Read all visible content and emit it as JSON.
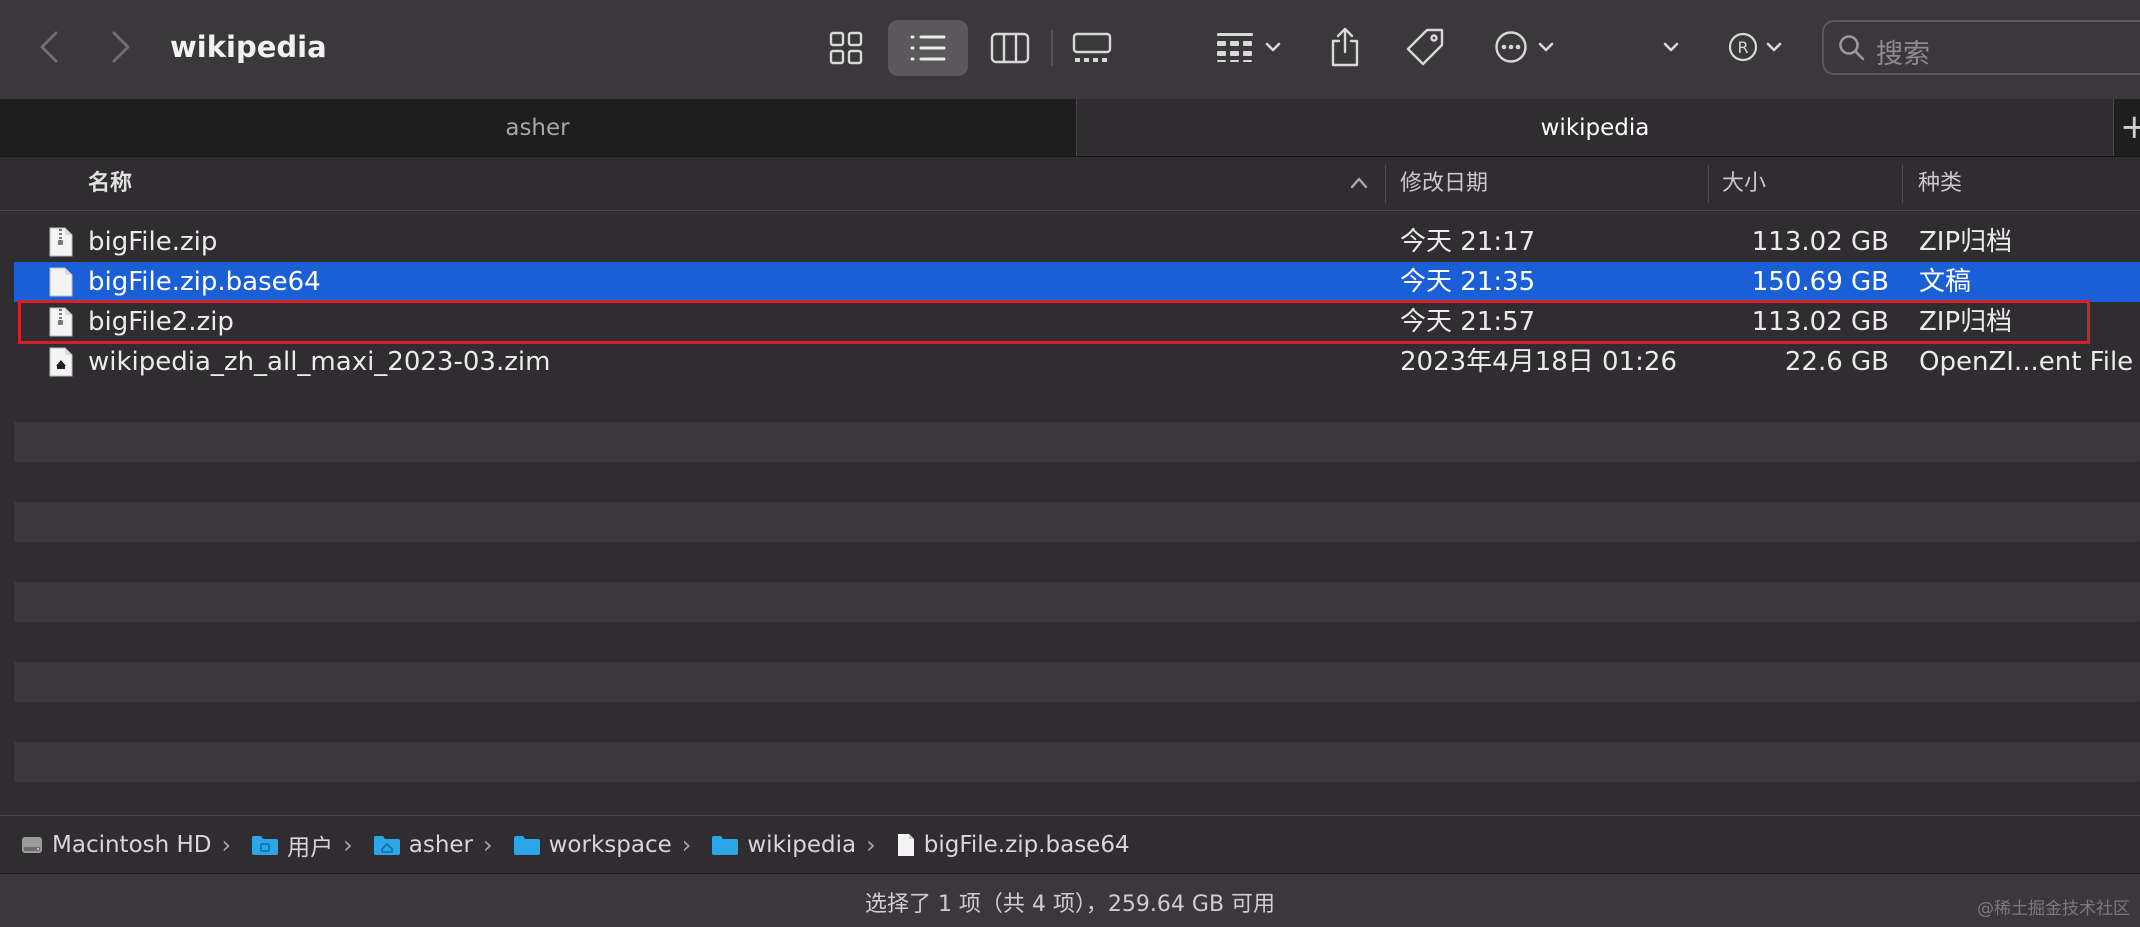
{
  "window": {
    "title": "wikipedia",
    "search_placeholder": "搜索"
  },
  "toolbar": {
    "icons": [
      "chevron-left-icon",
      "chevron-right-icon",
      "icon-view-icon",
      "list-view-icon",
      "column-view-icon",
      "gallery-view-icon",
      "group-icon",
      "share-icon",
      "tag-icon",
      "more-icon",
      "chevron-down-icon",
      "registered-icon",
      "search-icon"
    ]
  },
  "tabs": [
    {
      "label": "asher"
    },
    {
      "label": "wikipedia"
    }
  ],
  "columns": {
    "name": "名称",
    "date": "修改日期",
    "size": "大小",
    "kind": "种类"
  },
  "files": [
    {
      "name": "bigFile.zip",
      "date": "今天 21:17",
      "size": "113.02 GB",
      "kind": "ZIP归档",
      "selected": false
    },
    {
      "name": "bigFile.zip.base64",
      "date": "今天 21:35",
      "size": "150.69 GB",
      "kind": "文稿",
      "selected": true
    },
    {
      "name": "bigFile2.zip",
      "date": "今天 21:57",
      "size": "113.02 GB",
      "kind": "ZIP归档",
      "selected": false
    },
    {
      "name": "wikipedia_zh_all_maxi_2023-03.zim",
      "date": "2023年4月18日 01:26",
      "size": "22.6 GB",
      "kind": "OpenZI...ent File",
      "selected": false
    }
  ],
  "path": [
    {
      "label": "Macintosh HD",
      "icon": "hard-drive-icon"
    },
    {
      "label": "用户",
      "icon": "folder-icon"
    },
    {
      "label": "asher",
      "icon": "home-folder-icon"
    },
    {
      "label": "workspace",
      "icon": "folder-icon"
    },
    {
      "label": "wikipedia",
      "icon": "folder-icon"
    },
    {
      "label": "bigFile.zip.base64",
      "icon": "document-icon"
    }
  ],
  "status": "选择了 1 项（共 4 项），259.64 GB 可用",
  "watermark": "@稀土掘金技术社区",
  "colors": {
    "selection": "#1a5fd6",
    "highlight_box": "#d3202d"
  }
}
